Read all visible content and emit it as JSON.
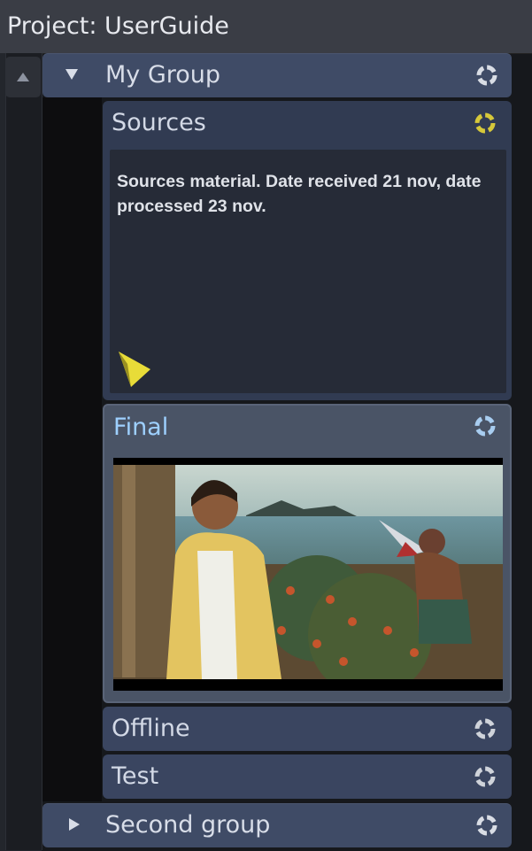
{
  "panel": {
    "title": "Project: UserGuide"
  },
  "groups": [
    {
      "label": "My Group",
      "expanded": true,
      "items": [
        {
          "label": "Sources",
          "note": "Sources material. Date received 21 nov, date processed 23 nov.",
          "status_color": "#d6c83a"
        },
        {
          "label": "Final",
          "selected": true,
          "status_color": "#a8cdf0"
        },
        {
          "label": "Offline",
          "status_color": "#cfd3da"
        },
        {
          "label": "Test",
          "status_color": "#cfd3da"
        }
      ]
    },
    {
      "label": "Second group",
      "expanded": false
    }
  ],
  "colors": {
    "group_bg": "#3f4b66",
    "item_bg": "#3a4560",
    "selected_label": "#9ed0ff",
    "note_flag": "#e8dc38"
  },
  "icons": {
    "scroll_up": "triangle-up-icon",
    "expanded": "triangle-down-icon",
    "collapsed": "triangle-right-icon",
    "status": "sync-icon",
    "note_flag": "note-flag-icon"
  }
}
